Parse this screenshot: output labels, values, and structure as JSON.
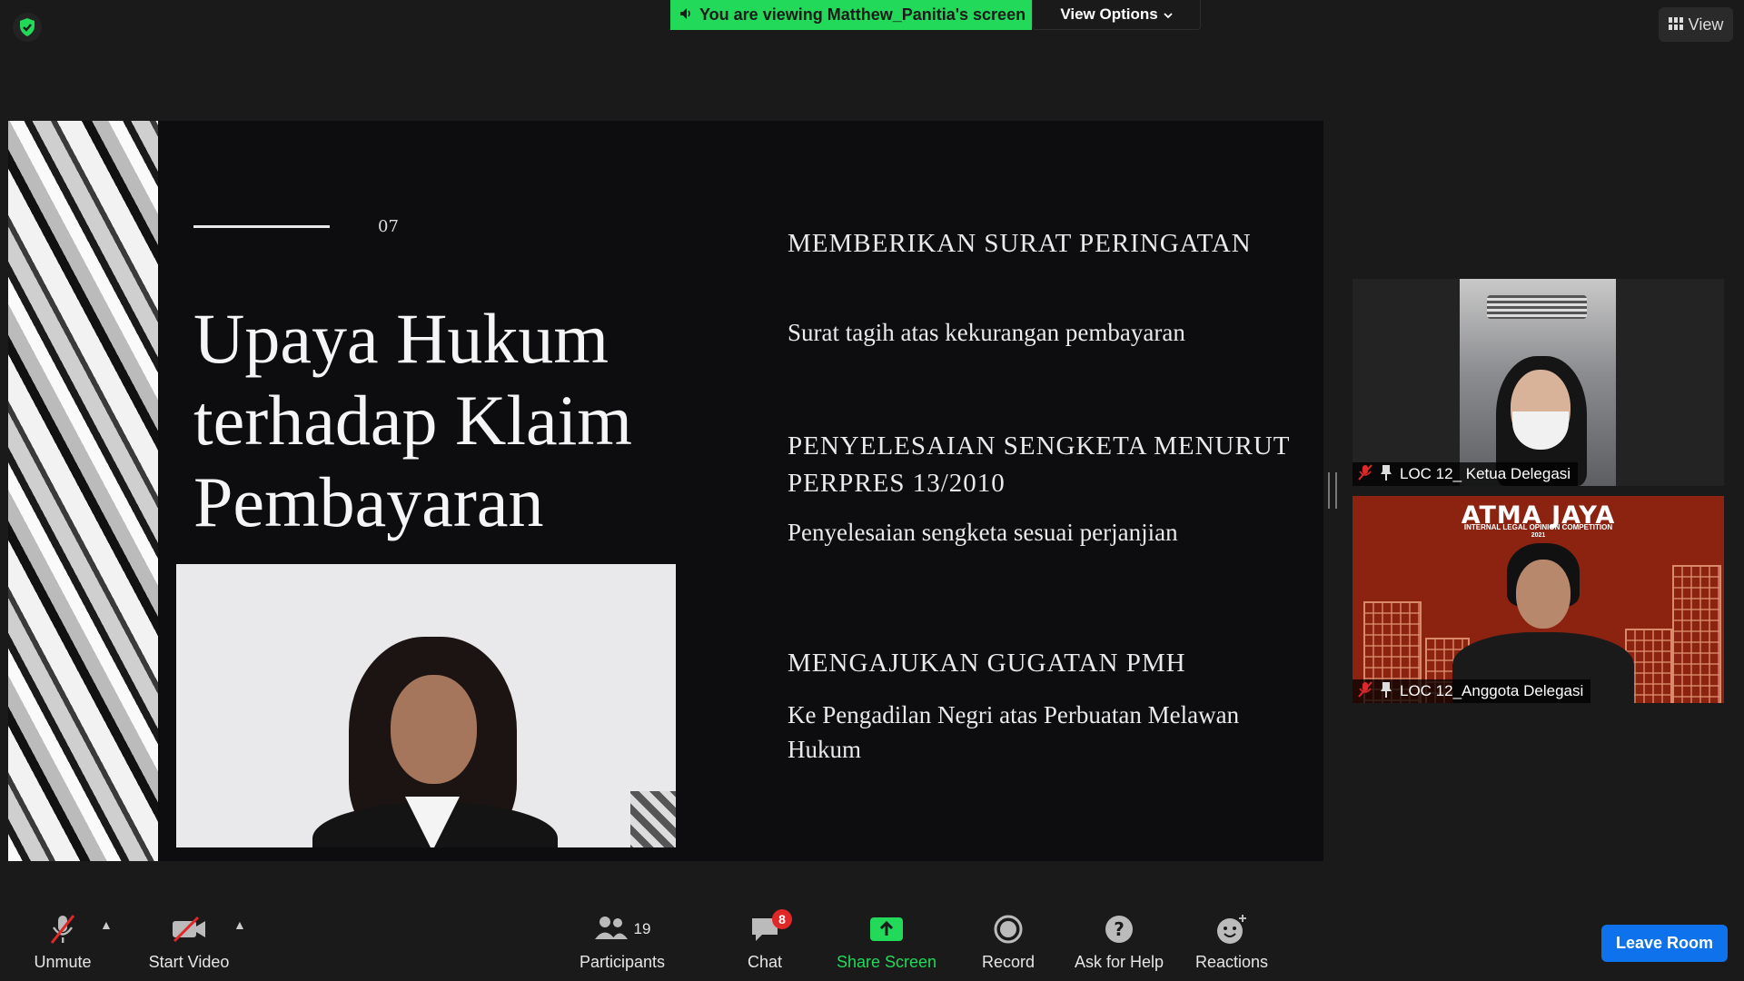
{
  "topbar": {
    "banner_text": "You are viewing Matthew_Panitia's screen",
    "view_options_label": "View Options",
    "view_label": "View",
    "security_icon": "shield-check-icon"
  },
  "slide": {
    "page_number": "07",
    "title": "Upaya Hukum terhadap Klaim Pembayaran",
    "items": [
      {
        "heading": "MEMBERIKAN SURAT PERINGATAN",
        "text": "Surat tagih atas kekurangan pembayaran"
      },
      {
        "heading": "PENYELESAIAN SENGKETA MENURUT PERPRES 13/2010",
        "text": "Penyelesaian sengketa sesuai perjanjian"
      },
      {
        "heading": "MENGAJUKAN GUGATAN PMH",
        "text": "Ke Pengadilan Negri atas Perbuatan Melawan Hukum"
      }
    ]
  },
  "participants_panel": [
    {
      "name": "LOC 12_ Ketua Delegasi"
    },
    {
      "name": "LOC 12_Anggota Delegasi",
      "background_brand": "ATMA JAYA",
      "background_subtitle": "INTERNAL LEGAL OPINION COMPETITION",
      "background_year": "2021"
    }
  ],
  "toolbar": {
    "unmute_label": "Unmute",
    "start_video_label": "Start Video",
    "participants_label": "Participants",
    "participants_count": "19",
    "chat_label": "Chat",
    "chat_badge": "8",
    "share_label": "Share Screen",
    "record_label": "Record",
    "help_label": "Ask for Help",
    "reactions_label": "Reactions",
    "leave_label": "Leave Room"
  },
  "colors": {
    "accent_green": "#23d959",
    "leave_blue": "#0e72ed",
    "badge_red": "#e02828"
  }
}
